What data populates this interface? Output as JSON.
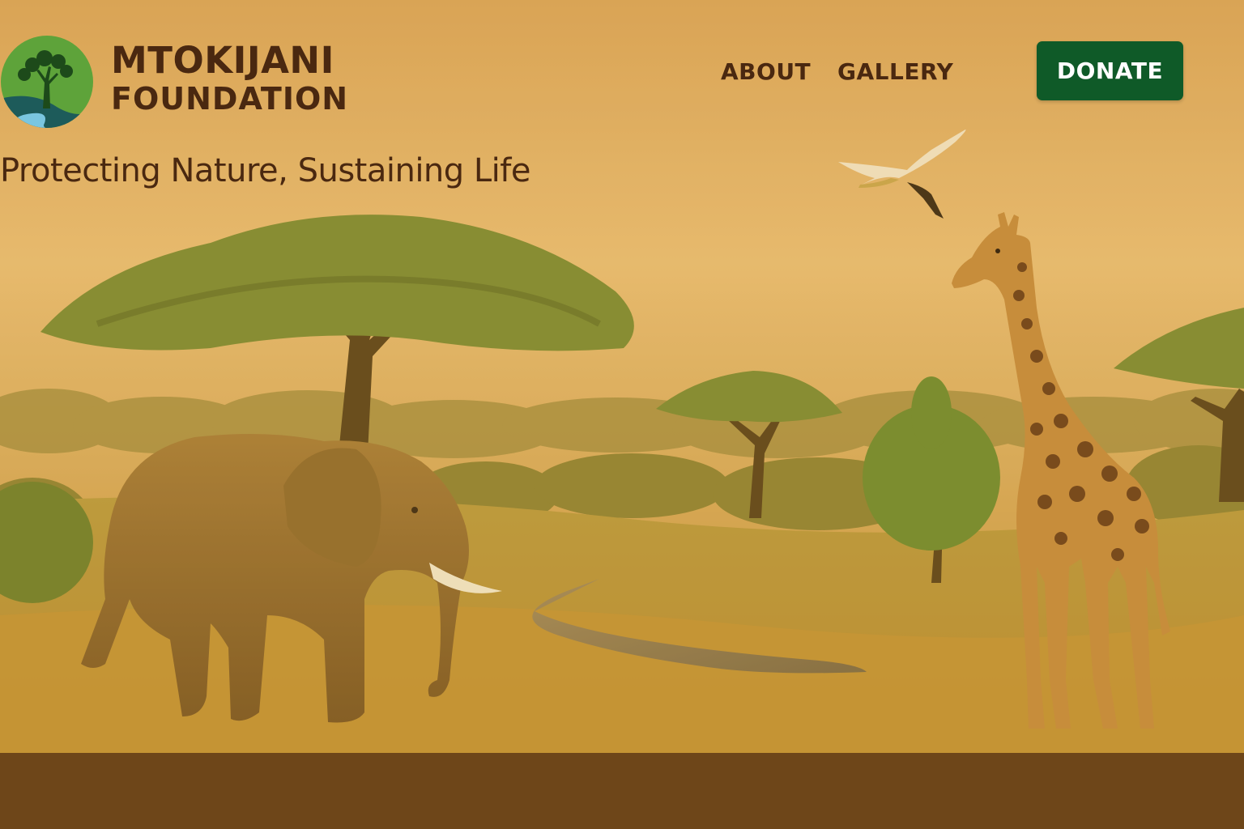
{
  "brand": {
    "name_line1": "MTOKIJANI",
    "name_line2": "FOUNDATION",
    "logo_icon": "tree-river-logo-icon"
  },
  "nav": {
    "items": [
      {
        "label": "ABOUT"
      },
      {
        "label": "GALLERY"
      }
    ],
    "donate_label": "DONATE"
  },
  "hero": {
    "tagline": "Protecting Nature, Sustaining Life",
    "scene": [
      "elephant",
      "acacia-tree",
      "giraffe",
      "egret",
      "river",
      "savanna-grass"
    ]
  },
  "colors": {
    "text_brown": "#4a2810",
    "donate_green": "#0f5a28",
    "sky_gold": "#e2b162",
    "footer_brown": "#6e4619"
  }
}
